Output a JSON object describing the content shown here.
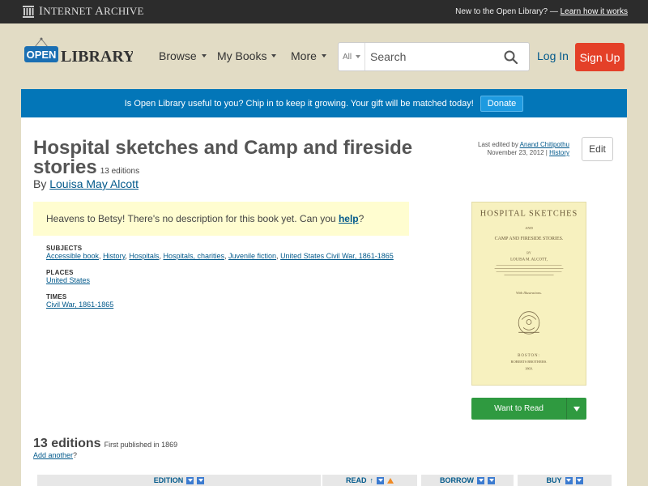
{
  "ia_bar": {
    "logo_text_first": "I",
    "logo_text_rest": "NTERNET ",
    "logo_text_a": "A",
    "logo_text_end": "RCHIVE",
    "new_prefix": "New to the Open Library? — ",
    "learn_link": "Learn how it works"
  },
  "header": {
    "logo_open": "OPEN",
    "logo_library": "LIBRARY",
    "nav": {
      "browse": "Browse",
      "my_books": "My Books",
      "more": "More"
    },
    "search": {
      "scope": "All",
      "placeholder": "Search"
    },
    "login": "Log In",
    "signup": "Sign Up"
  },
  "banner": {
    "text": "Is Open Library useful to you? Chip in to keep it growing. Your gift will be matched today!",
    "donate": "Donate"
  },
  "book": {
    "title": "Hospital sketches and Camp and fireside stories",
    "editions_count": "13 editions",
    "by": "By ",
    "author": "Louisa May Alcott",
    "last_edited_prefix": "Last edited by ",
    "last_edited_user": "Anand Chitipothu",
    "last_edited_date": "November 23, 2012 | ",
    "history_link": "History",
    "edit_button": "Edit",
    "description_text": "Heavens to Betsy! There's no description for this book yet. Can you ",
    "description_help": "help",
    "description_end": "?",
    "subjects_head": "SUBJECTS",
    "subjects": [
      "Accessible book",
      "History",
      "Hospitals",
      "Hospitals, charities",
      "Juvenile fiction",
      "United States Civil War, 1861-1865"
    ],
    "places_head": "PLACES",
    "places": [
      "United States"
    ],
    "times_head": "TIMES",
    "times": [
      "Civil War, 1861-1865"
    ],
    "cover": {
      "title_line1": "HOSPITAL SKETCHES",
      "and": "AND",
      "title_line2": "CAMP AND FIRESIDE STORIES.",
      "by": "BY",
      "author": "LOUISA M. ALCOTT,",
      "illustrations": "With Illustrations.",
      "city": "BOSTON:",
      "publisher": "ROBERTS BROTHERS.",
      "year": "1869."
    },
    "want_to_read": "Want to Read"
  },
  "editions": {
    "title": "13 editions",
    "first_published": "First published in 1869",
    "add_another": "Add another",
    "add_another_q": "?",
    "columns": {
      "edition": "EDITION",
      "read": "READ",
      "borrow": "BORROW",
      "buy": "BUY"
    }
  }
}
